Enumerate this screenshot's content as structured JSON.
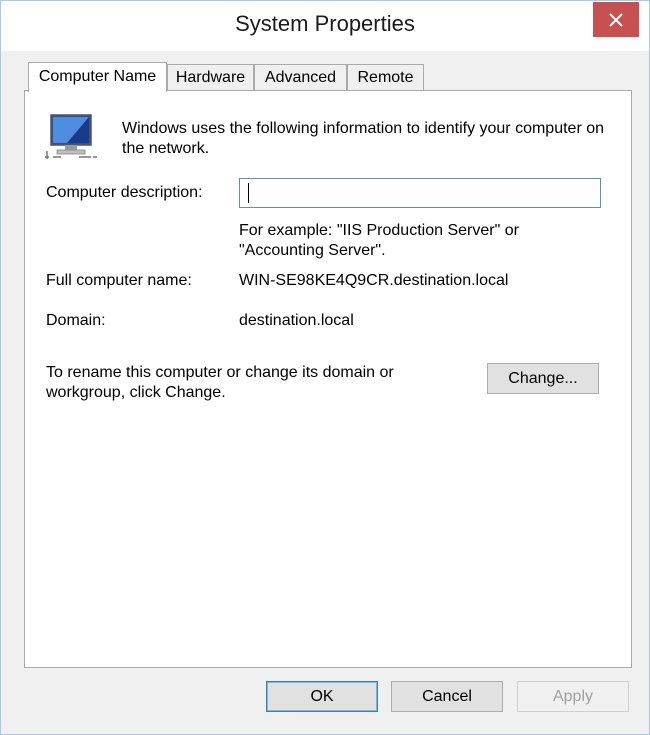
{
  "window": {
    "title": "System Properties"
  },
  "tabs": [
    "Computer Name",
    "Hardware",
    "Advanced",
    "Remote"
  ],
  "panel": {
    "intro": "Windows uses the following information to identify your computer on the network.",
    "description_label": "Computer description:",
    "description_value": "",
    "example_text": "For example: \"IIS Production Server\" or \"Accounting Server\".",
    "full_name_label": "Full computer name:",
    "full_name_value": "WIN-SE98KE4Q9CR.destination.local",
    "domain_label": "Domain:",
    "domain_value": "destination.local",
    "rename_text": "To rename this computer or change its domain or workgroup, click Change.",
    "change_label": "Change..."
  },
  "footer": {
    "ok": "OK",
    "cancel": "Cancel",
    "apply": "Apply"
  },
  "icons": {
    "computer": "computer-network-icon",
    "close": "close-icon"
  },
  "colors": {
    "close_button": "#c75050",
    "panel_bg": "#ffffff",
    "dialog_bg": "#f0f0f0"
  }
}
